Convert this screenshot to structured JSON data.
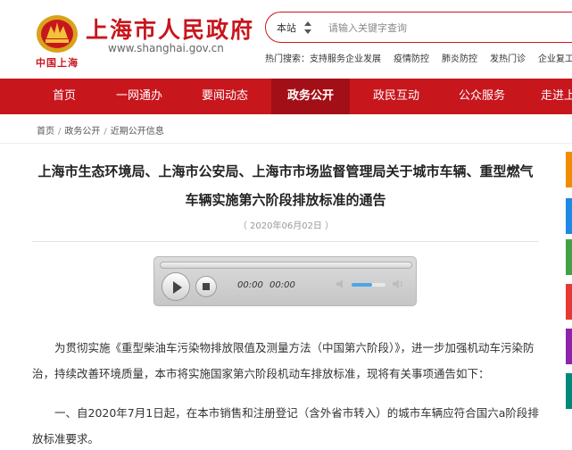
{
  "header": {
    "site_title": "上海市人民政府",
    "site_url": "www.shanghai.gov.cn",
    "logo_sub": "中国上海",
    "search": {
      "scope": "本站",
      "placeholder": "请输入关键字查询"
    },
    "hot_search": {
      "label": "热门搜索：",
      "items": [
        "支持服务企业发展",
        "疫情防控",
        "肺炎防控",
        "发热门诊",
        "企业复工"
      ]
    }
  },
  "nav": {
    "items": [
      "首页",
      "一网通办",
      "要闻动态",
      "政务公开",
      "政民互动",
      "公众服务",
      "走进上海"
    ],
    "active_index": 3
  },
  "breadcrumb": [
    "首页",
    "政务公开",
    "近期公开信息"
  ],
  "article": {
    "title": "上海市生态环境局、上海市公安局、上海市市场监督管理局关于城市车辆、重型燃气车辆实施第六阶段排放标准的通告",
    "date": "（ 2020年06月02日 ）",
    "player": {
      "current_time": "00:00",
      "duration": "00:00",
      "volume": 0.6
    },
    "paragraphs": [
      "为贯彻实施《重型柴油车污染物排放限值及测量方法（中国第六阶段）》，进一步加强机动车污染防治，持续改善环境质量，本市将实施国家第六阶段机动车排放标准，现将有关事项通告如下：",
      "一、自2020年7月1日起，在本市销售和注册登记（含外省市转入）的城市车辆应符合国六a阶段排放标准要求。"
    ]
  },
  "colors": {
    "brand_red": "#c8161d",
    "nav_active": "#a30f16",
    "side_stubs": [
      "#f08c00",
      "#1e88e5",
      "#43a047",
      "#e53935",
      "#8e24aa",
      "#00897b"
    ]
  }
}
